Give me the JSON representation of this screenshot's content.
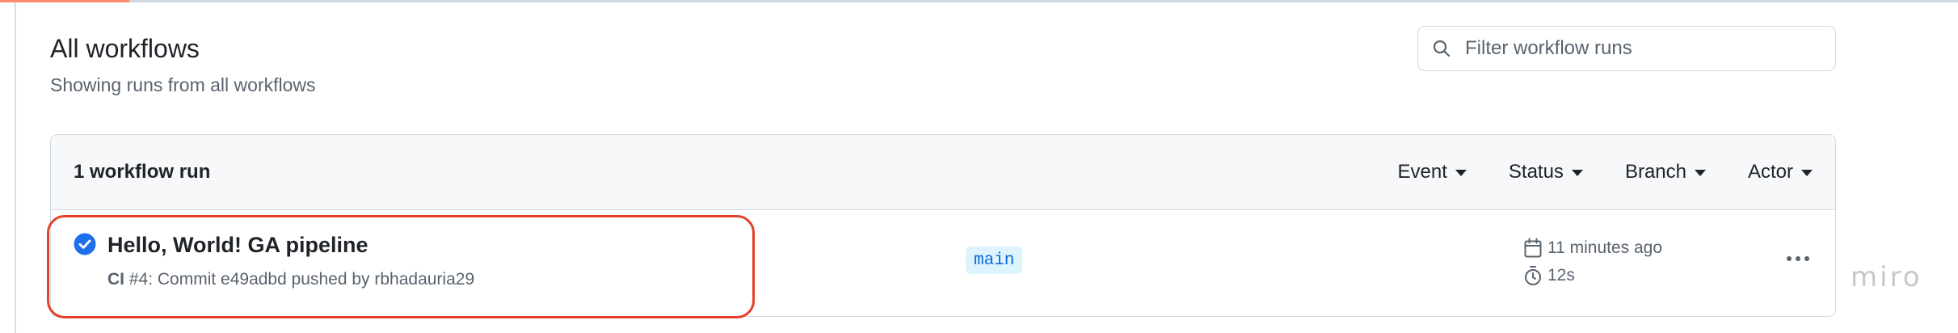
{
  "header": {
    "title": "All workflows",
    "subtitle": "Showing runs from all workflows"
  },
  "search": {
    "placeholder": "Filter workflow runs"
  },
  "runs_box": {
    "count_label": "1 workflow run",
    "filters": [
      "Event",
      "Status",
      "Branch",
      "Actor"
    ]
  },
  "run": {
    "status": "success",
    "title": "Hello, World! GA pipeline",
    "workflow": "CI",
    "meta_suffix": " #4: Commit e49adbd pushed by rbhadauria29",
    "branch": "main",
    "time_ago": "11 minutes ago",
    "duration": "12s"
  },
  "watermark": "miro",
  "colors": {
    "success": "#1f6feb",
    "highlight": "#e3412c",
    "tab_accent": "#fd8c73",
    "branch_bg": "#ddf4ff",
    "branch_text": "#0969da"
  },
  "icons": {
    "search": "search-icon",
    "status": "check-circle-icon",
    "calendar": "calendar-icon",
    "stopwatch": "stopwatch-icon",
    "more": "kebab-horizontal-icon",
    "caret": "triangle-down-icon"
  }
}
